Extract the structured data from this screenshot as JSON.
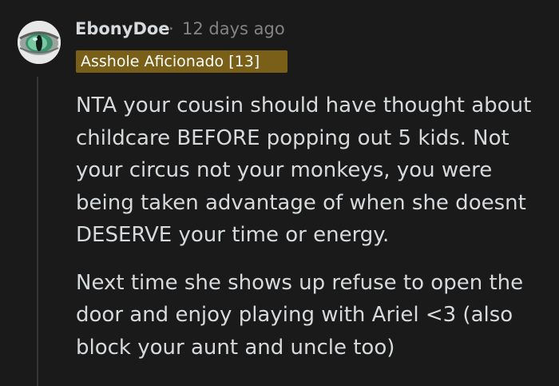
{
  "comment": {
    "author": "EbonyDoe",
    "separator": "·",
    "timestamp": "12 days ago",
    "flair": "Asshole Aficionado [13]",
    "avatar_icon": "cat-eye-avatar-icon",
    "paragraphs": [
      "NTA your cousin should have thought about childcare BEFORE popping out 5 kids. Not your circus not your monkeys, you were being taken advantage of when she doesnt DESERVE your time or energy.",
      "Next time she shows up refuse to open the door and enjoy playing with Ariel <3 (also block your aunt and uncle too)"
    ]
  },
  "colors": {
    "background": "#1a1a1b",
    "text": "#d7dadc",
    "muted": "#818384",
    "flair_bg": "#7a5f18",
    "thread_line": "#343536"
  }
}
